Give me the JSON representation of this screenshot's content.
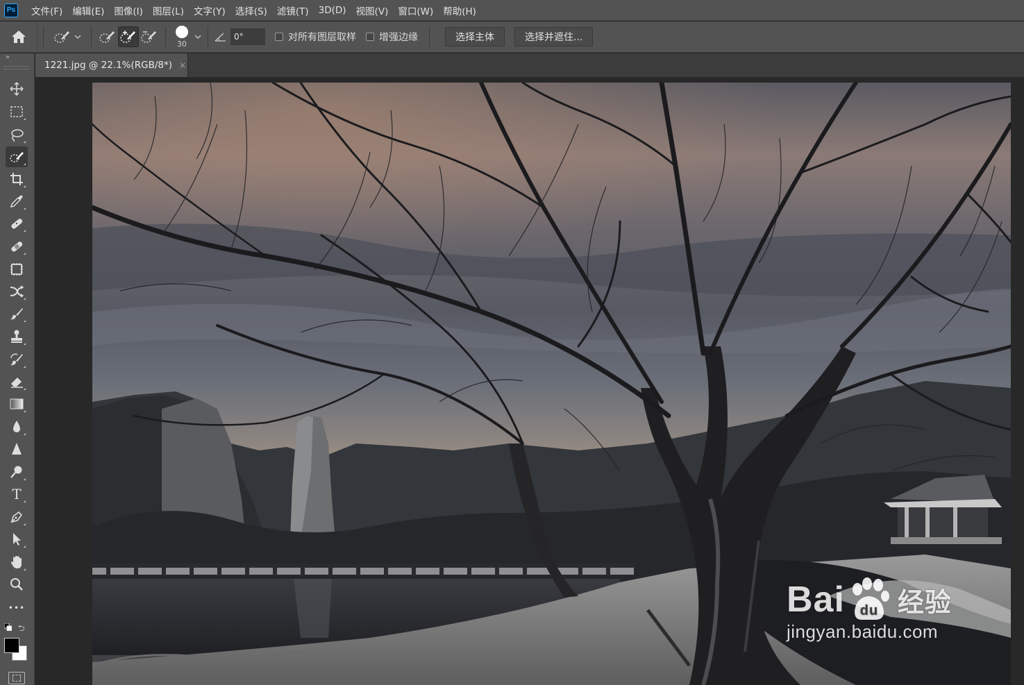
{
  "app": {
    "logo_text": "Ps"
  },
  "menu": [
    "文件(F)",
    "编辑(E)",
    "图像(I)",
    "图层(L)",
    "文字(Y)",
    "选择(S)",
    "滤镜(T)",
    "3D(D)",
    "视图(V)",
    "窗口(W)",
    "帮助(H)"
  ],
  "options": {
    "brush_size": "30",
    "angle_value": "0°",
    "sample_all_layers_label": "对所有图层取样",
    "sample_all_layers_checked": false,
    "enhance_edge_label": "增强边缘",
    "enhance_edge_checked": false,
    "select_subject_label": "选择主体",
    "select_and_mask_label": "选择并遮住..."
  },
  "document": {
    "tab_title": "1221.jpg @ 22.1%(RGB/8*)",
    "close_glyph": "×"
  },
  "toolbar": {
    "collapse_glyph": "»",
    "active_tool": "quick-selection-tool",
    "tools": [
      "move",
      "marquee",
      "lasso",
      "quick-selection",
      "crop",
      "eyedropper",
      "spot-healing",
      "healing-patch",
      "frame",
      "content-aware-move",
      "brush",
      "clone-stamp",
      "history-brush",
      "eraser",
      "gradient",
      "blur",
      "sharpen",
      "dodge",
      "type",
      "pen",
      "path-selection",
      "hand",
      "zoom",
      "more"
    ],
    "type_tool_glyph": "T",
    "more_glyph": "•••",
    "swap_glyph": "⮌",
    "foreground_color": "#000000",
    "background_color": "#ffffff"
  },
  "watermark": {
    "brand_left": "Bai",
    "brand_right": "经验",
    "url": "jingyan.baidu.com"
  }
}
